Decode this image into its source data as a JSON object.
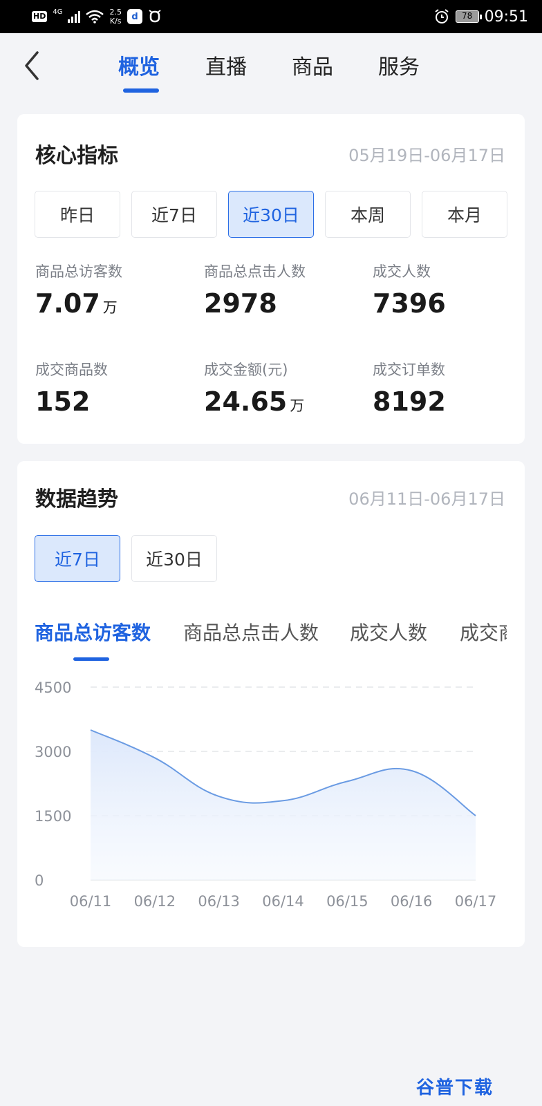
{
  "status_bar": {
    "hd": "HD",
    "network": "4G",
    "speed": "2.5\nK/s",
    "speed_top": "2.5",
    "speed_bottom": "K/s",
    "battery": "78",
    "time": "09:51"
  },
  "nav": {
    "tabs": [
      {
        "label": "概览",
        "active": true
      },
      {
        "label": "直播",
        "active": false
      },
      {
        "label": "商品",
        "active": false
      },
      {
        "label": "服务",
        "active": false
      }
    ]
  },
  "core": {
    "title": "核心指标",
    "date_range": "05月19日-06月17日",
    "periods": [
      {
        "label": "昨日",
        "active": false
      },
      {
        "label": "近7日",
        "active": false
      },
      {
        "label": "近30日",
        "active": true
      },
      {
        "label": "本周",
        "active": false
      },
      {
        "label": "本月",
        "active": false
      }
    ],
    "metrics": [
      {
        "label": "商品总访客数",
        "value": "7.07",
        "unit": "万"
      },
      {
        "label": "商品总点击人数",
        "value": "2978",
        "unit": ""
      },
      {
        "label": "成交人数",
        "value": "7396",
        "unit": ""
      },
      {
        "label": "成交商品数",
        "value": "152",
        "unit": ""
      },
      {
        "label": "成交金额(元)",
        "value": "24.65",
        "unit": "万"
      },
      {
        "label": "成交订单数",
        "value": "8192",
        "unit": ""
      }
    ]
  },
  "trend": {
    "title": "数据趋势",
    "date_range": "06月11日-06月17日",
    "periods": [
      {
        "label": "近7日",
        "active": true
      },
      {
        "label": "近30日",
        "active": false
      }
    ],
    "metric_tabs": [
      {
        "label": "商品总访客数",
        "active": true
      },
      {
        "label": "商品总点击人数",
        "active": false
      },
      {
        "label": "成交人数",
        "active": false
      },
      {
        "label": "成交商",
        "active": false
      }
    ]
  },
  "chart_data": {
    "type": "area",
    "categories": [
      "06/11",
      "06/12",
      "06/13",
      "06/14",
      "06/15",
      "06/16",
      "06/17"
    ],
    "series": [
      {
        "values": [
          3500,
          2850,
          1950,
          1850,
          2300,
          2550,
          1500
        ]
      }
    ],
    "y_ticks": [
      "0",
      "1500",
      "3000",
      "4500"
    ],
    "ylim": [
      0,
      4500
    ],
    "grid": true,
    "line_color": "#6a9be3",
    "fill_color": "#e7effc"
  },
  "watermark": "谷普下载",
  "colors": {
    "accent": "#1f63e0",
    "background": "#f3f4f7"
  }
}
